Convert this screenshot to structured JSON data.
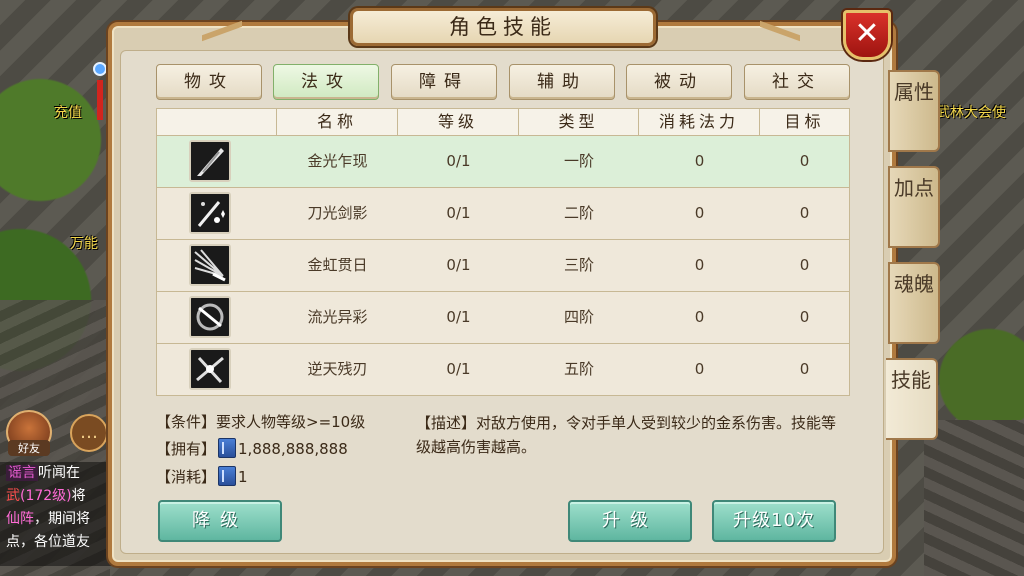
{
  "window": {
    "title": "角色技能"
  },
  "background": {
    "charge_label": "充值",
    "wanneng_label": "万能",
    "wulin_label": "武林大会使",
    "friend_label": "好友",
    "chat": {
      "line1_tag": "谣言",
      "line1_text": "听闻在",
      "line2_a": "武",
      "line2_b": "(172级)",
      "line2_c": "将",
      "line3_a": "仙阵",
      "line3_b": "，期间将",
      "line4": "点，各位道友"
    }
  },
  "tabs": [
    {
      "label": "物攻",
      "active": false
    },
    {
      "label": "法攻",
      "active": true
    },
    {
      "label": "障碍",
      "active": false
    },
    {
      "label": "辅助",
      "active": false
    },
    {
      "label": "被动",
      "active": false
    },
    {
      "label": "社交",
      "active": false
    }
  ],
  "table": {
    "headers": [
      "",
      "名称",
      "等级",
      "类型",
      "消耗法力",
      "目标"
    ],
    "rows": [
      {
        "icon": "sword-burst-icon",
        "name": "金光乍现",
        "level": "0/1",
        "type": "一阶",
        "mana": "0",
        "target": "0",
        "selected": true
      },
      {
        "icon": "sword-sparkle-icon",
        "name": "刀光剑影",
        "level": "0/1",
        "type": "二阶",
        "mana": "0",
        "target": "0",
        "selected": false
      },
      {
        "icon": "sword-rays-icon",
        "name": "金虹贯日",
        "level": "0/1",
        "type": "三阶",
        "mana": "0",
        "target": "0",
        "selected": false
      },
      {
        "icon": "blade-swirl-icon",
        "name": "流光异彩",
        "level": "0/1",
        "type": "四阶",
        "mana": "0",
        "target": "0",
        "selected": false
      },
      {
        "icon": "blade-cross-icon",
        "name": "逆天残刃",
        "level": "0/1",
        "type": "五阶",
        "mana": "0",
        "target": "0",
        "selected": false
      }
    ]
  },
  "info": {
    "condition": "【条件】要求人物等级>=10级",
    "own_label": "【拥有】",
    "own_value": "1,888,888,888",
    "cost_label": "【消耗】",
    "cost_value": "1",
    "description": "【描述】对敌方使用，令对手单人受到较少的金系伤害。技能等级越高伤害越高。"
  },
  "buttons": {
    "downgrade": "降级",
    "upgrade": "升级",
    "upgrade10": "升级10次"
  },
  "side_tabs": [
    {
      "label": "属性",
      "active": false
    },
    {
      "label": "加点",
      "active": false
    },
    {
      "label": "魂魄",
      "active": false
    },
    {
      "label": "技能",
      "active": true
    }
  ],
  "colors": {
    "active_tab": "#cfe9c0",
    "selected_row": "#dcefd8",
    "button": "#6fc0aa",
    "close": "#c4241e"
  }
}
